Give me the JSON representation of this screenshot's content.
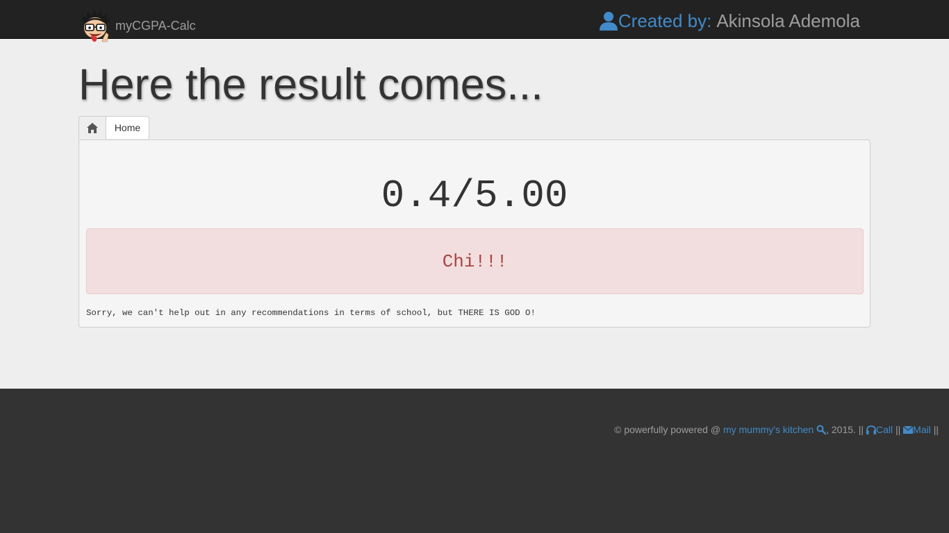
{
  "navbar": {
    "brand": "myCGPA-Calc",
    "credit_label": "Created by:",
    "credit_name": "Akinsola Ademola",
    "logo_icon": "cartoon-face-logo",
    "user_icon": "user-icon"
  },
  "page": {
    "title": "Here the result comes..."
  },
  "tabs": {
    "home_icon": "home-icon",
    "home_label": "Home"
  },
  "result": {
    "score": "0.4/5.00",
    "alert": "Chi!!!",
    "note": "Sorry, we can't help out in any recommendations in terms of school, but THERE IS GOD O!"
  },
  "footer": {
    "prefix": "© powerfully powered @",
    "kitchen_link": "my mummy's kitchen",
    "year_text": ", 2015. ||",
    "call_label": "Call",
    "sep1": "||",
    "mail_label": "Mail",
    "sep2": "||"
  },
  "colors": {
    "navbar_bg": "#222222",
    "link": "#428bca",
    "alert_bg": "#f2dede",
    "alert_text": "#a94442",
    "footer_bg": "#333333"
  }
}
